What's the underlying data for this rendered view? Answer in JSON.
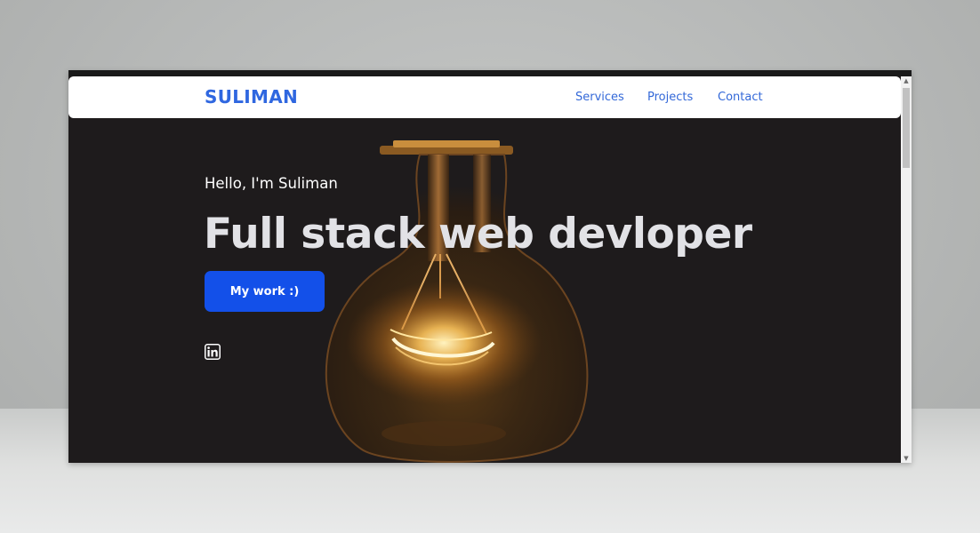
{
  "nav": {
    "brand": "SULIMAN",
    "links": [
      {
        "label": "Services"
      },
      {
        "label": "Projects"
      },
      {
        "label": "Contact"
      }
    ]
  },
  "hero": {
    "greeting": "Hello, I'm Suliman",
    "headline": "Full stack web devloper",
    "cta_label": "My work :)"
  },
  "social": {
    "icons": [
      "linkedin-icon"
    ]
  },
  "colors": {
    "brand": "#2f67e0",
    "nav_link": "#3368d8",
    "cta": "#1350e9",
    "hero_background": "#1e1b1c",
    "bulb_glow": "#f2a640"
  }
}
